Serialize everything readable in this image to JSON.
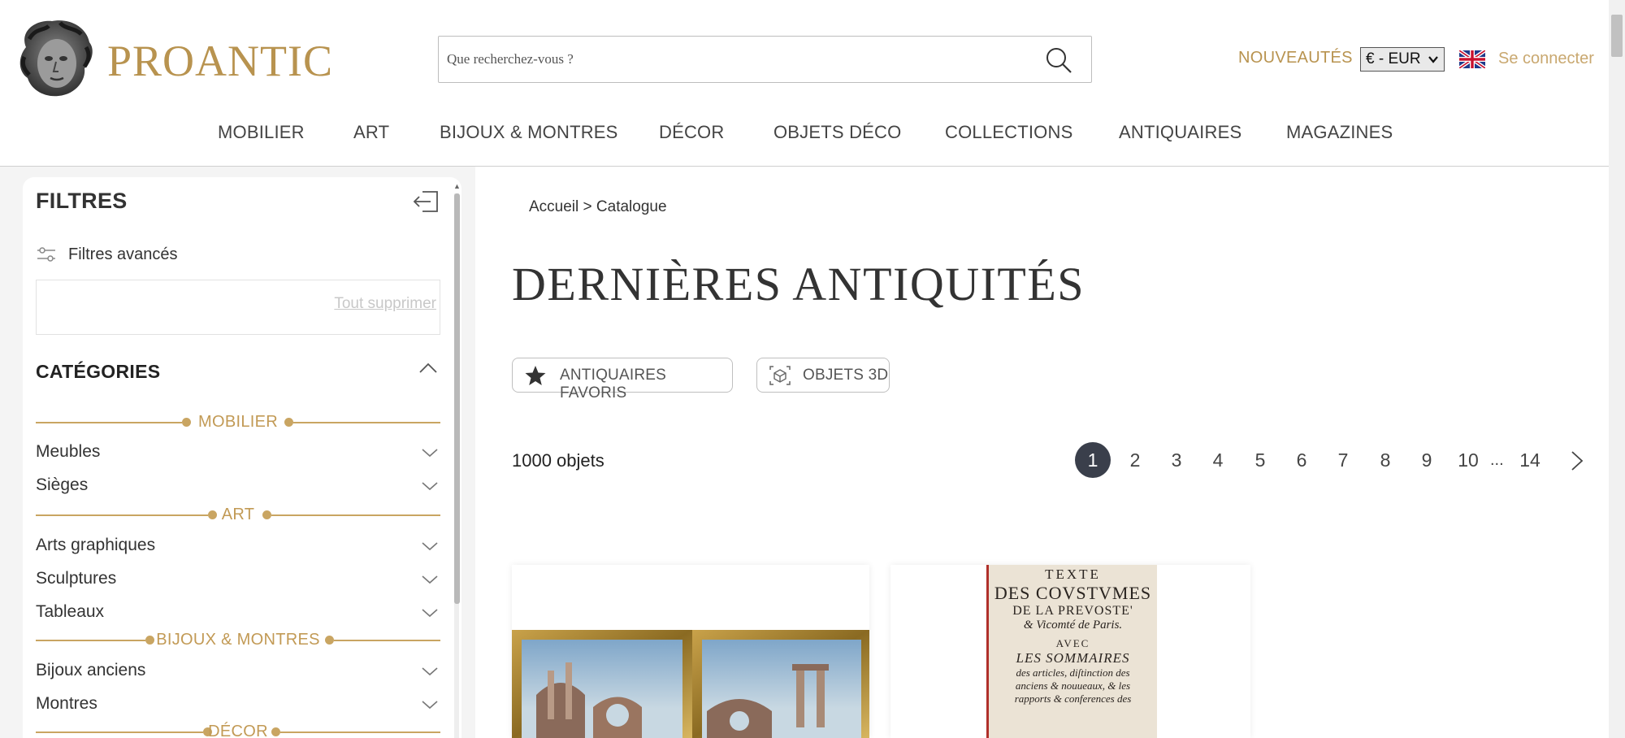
{
  "header": {
    "brand": "PROANTIC",
    "search_placeholder": "Que recherchez-vous ?",
    "nouveautes": "NOUVEAUTÉS",
    "currency": "€ - EUR",
    "connect": "Se connecter",
    "nav": [
      "MOBILIER",
      "ART",
      "BIJOUX & MONTRES",
      "DÉCOR",
      "OBJETS DÉCO",
      "COLLECTIONS",
      "ANTIQUAIRES",
      "MAGAZINES"
    ]
  },
  "sidebar": {
    "title": "FILTRES",
    "advanced": "Filtres avancés",
    "clear_all": "Tout supprimer",
    "categories_title": "CATÉGORIES",
    "groups": [
      {
        "label": "MOBILIER",
        "items": [
          "Meubles",
          "Sièges"
        ]
      },
      {
        "label": "ART",
        "items": [
          "Arts graphiques",
          "Sculptures",
          "Tableaux"
        ]
      },
      {
        "label": "BIJOUX & MONTRES",
        "items": [
          "Bijoux anciens",
          "Montres"
        ]
      },
      {
        "label": "DÉCOR",
        "items": []
      }
    ]
  },
  "main": {
    "breadcrumb": "Accueil > Catalogue",
    "title": "DERNIÈRES ANTIQUITÉS",
    "chips": [
      "ANTIQUAIRES FAVORIS",
      "OBJETS 3D"
    ],
    "count": "1000 objets",
    "pages": [
      "1",
      "2",
      "3",
      "4",
      "5",
      "6",
      "7",
      "8",
      "9",
      "10"
    ],
    "ellipsis": "...",
    "last_page": "14",
    "book_text": [
      "TEXTE",
      "DES COVSTVMES",
      "DE LA PREVOSTE'",
      "& Vicomté de Paris.",
      "AVEC",
      "LES SOMMAIRES",
      "des articles, diſtinction des",
      "anciens & nouueaux, & les",
      "rapports & conferences des"
    ]
  },
  "colors": {
    "gold": "#b8934f",
    "gold_line": "#c9a562",
    "pager_active": "#3a3f4b"
  }
}
